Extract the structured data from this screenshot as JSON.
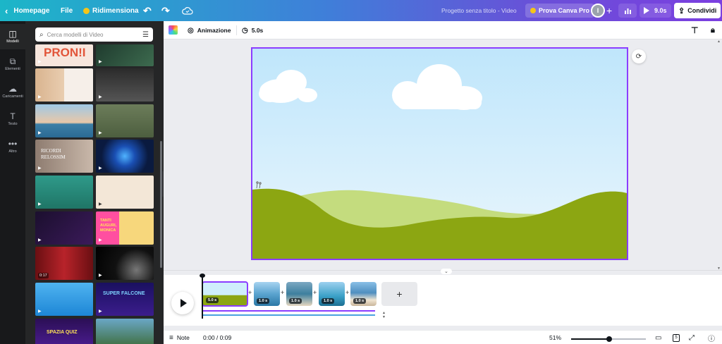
{
  "topbar": {
    "back_label": "Homepage",
    "file_label": "File",
    "resize_label": "Ridimensiona",
    "project_title": "Progetto senza titolo - Video",
    "pro_label": "Prova Canva Pro",
    "avatar_initial": "I",
    "play_duration": "9.0s",
    "share_label": "Condividi",
    "accent_color": "#8b3dff"
  },
  "sidebar": {
    "items": [
      {
        "label": "Modelli",
        "icon": "layout-icon"
      },
      {
        "label": "Elementi",
        "icon": "shapes-icon"
      },
      {
        "label": "Caricamenti",
        "icon": "cloud-upload-icon"
      },
      {
        "label": "Testo",
        "icon": "text-icon"
      },
      {
        "label": "Altro",
        "icon": "more-icon"
      }
    ]
  },
  "panel": {
    "search_placeholder": "Cerca modelli di Video",
    "templates": [
      {
        "text": "PRON!I",
        "duration": ""
      },
      {
        "text": "",
        "duration": ""
      },
      {
        "text": "",
        "duration": ""
      },
      {
        "text": "",
        "duration": ""
      },
      {
        "text": "",
        "duration": ""
      },
      {
        "text": "",
        "duration": ""
      },
      {
        "text": "RICORDI RELOSSIM",
        "duration": ""
      },
      {
        "text": "",
        "duration": ""
      },
      {
        "text": "",
        "duration": ""
      },
      {
        "text": "",
        "duration": ""
      },
      {
        "text": "",
        "duration": ""
      },
      {
        "text": "TANTI AUGURI, MONICA",
        "duration": ""
      },
      {
        "text": "",
        "duration": "0:17"
      },
      {
        "text": "",
        "duration": ""
      },
      {
        "text": "",
        "duration": ""
      },
      {
        "text": "SUPER FALCONE",
        "duration": ""
      },
      {
        "text": "SPAZIA QUIZ",
        "duration": ""
      },
      {
        "text": "",
        "duration": ""
      }
    ]
  },
  "toolbar": {
    "animation_label": "Animazione",
    "duration_label": "5.0s"
  },
  "timeline": {
    "clips": [
      {
        "duration": "5.0 s",
        "selected": true
      },
      {
        "duration": "1.0 s",
        "selected": false
      },
      {
        "duration": "1.0 s",
        "selected": false
      },
      {
        "duration": "1.0 s",
        "selected": false
      },
      {
        "duration": "1.0 s",
        "selected": false
      }
    ],
    "add_label": "+"
  },
  "bottombar": {
    "notes_label": "Note",
    "time_label": "0:00 / 0:09",
    "zoom_label": "51%",
    "zoom_value": 0.51,
    "page_count": "5"
  }
}
